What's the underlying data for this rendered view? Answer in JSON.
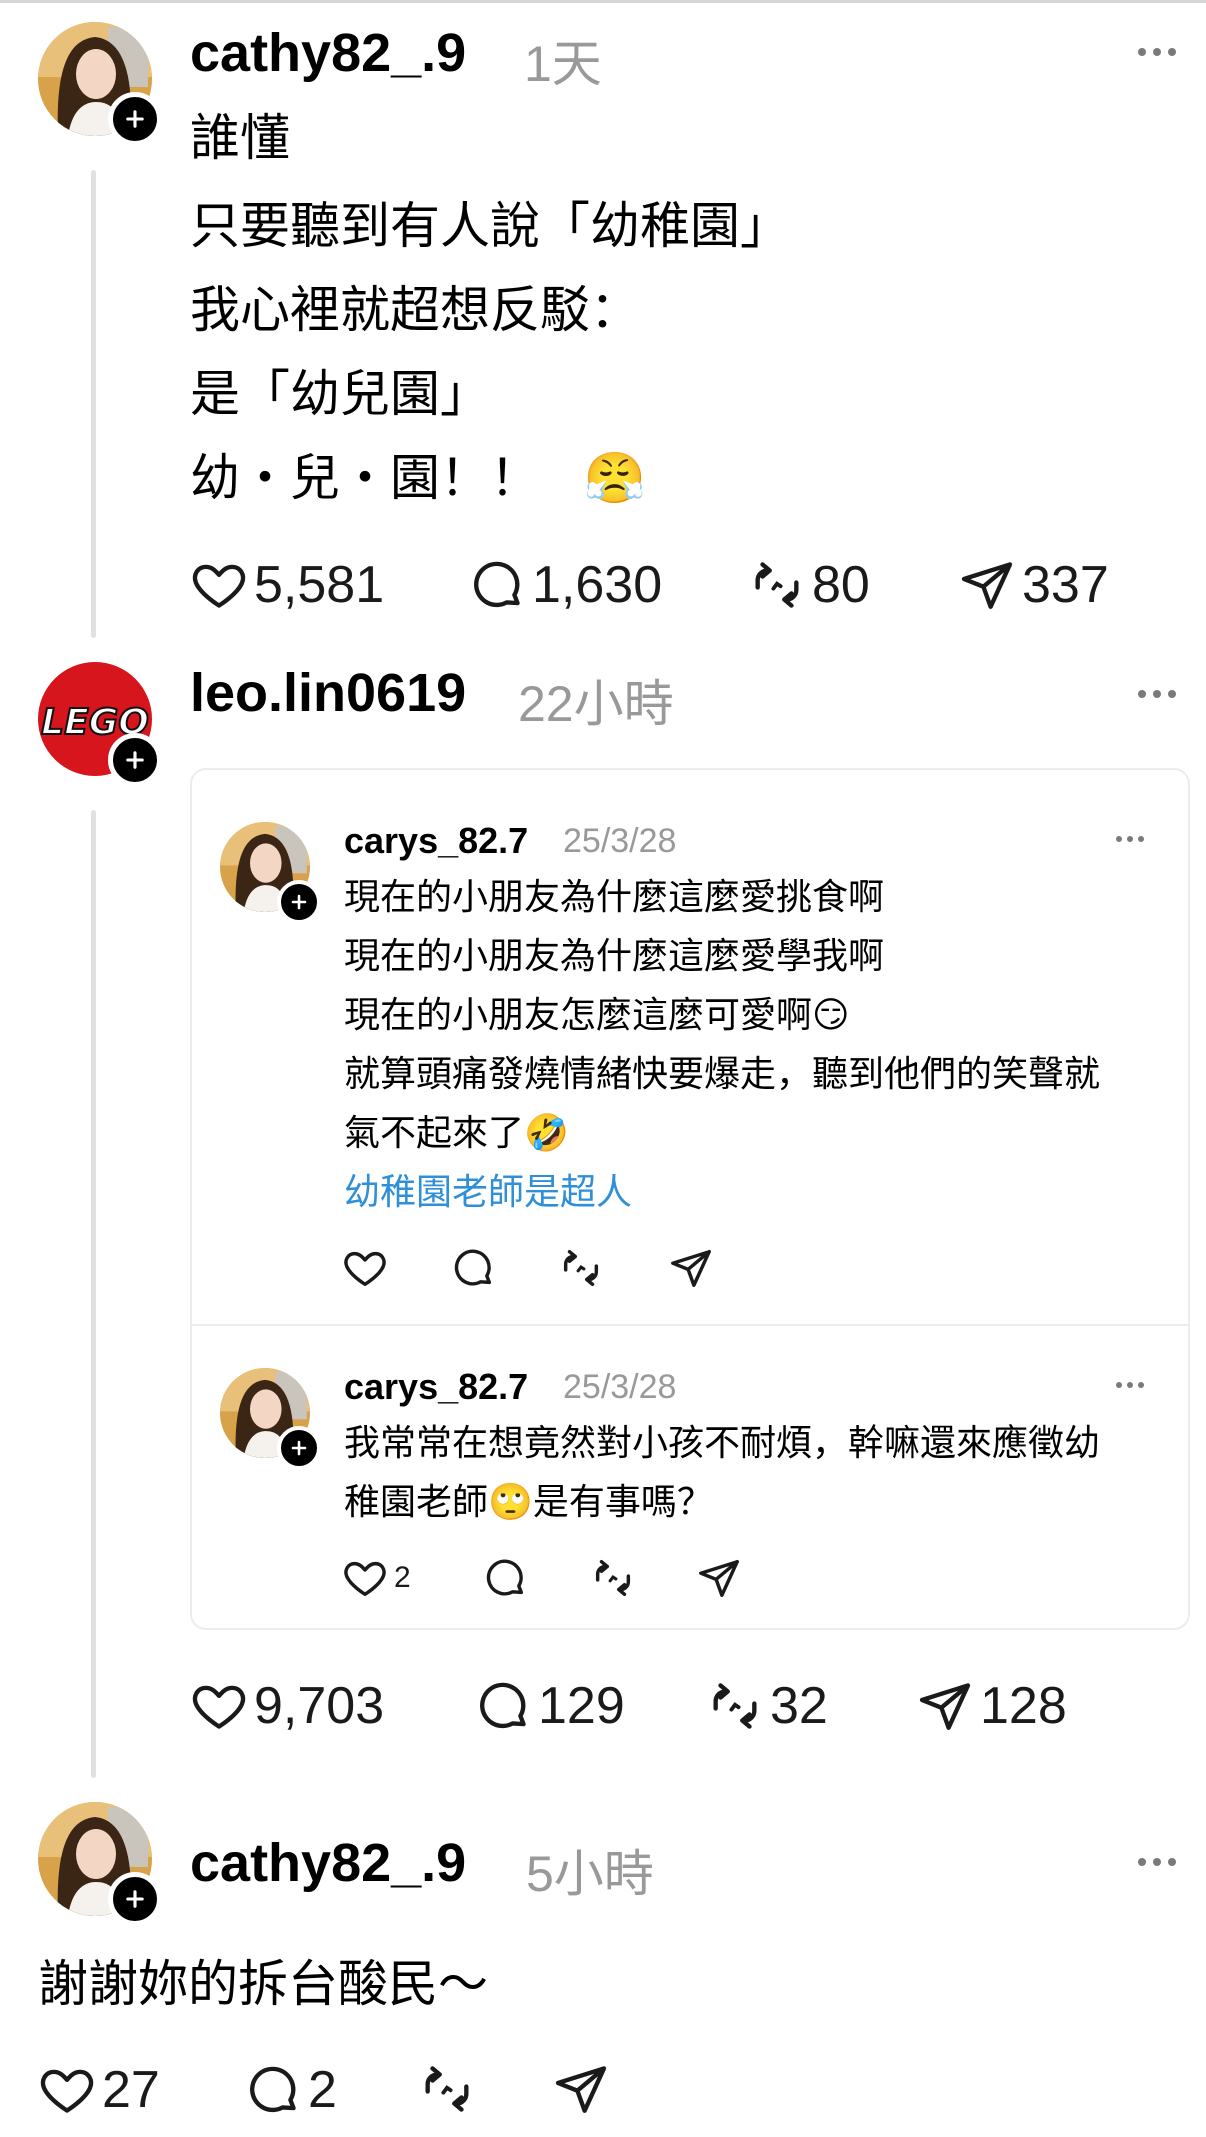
{
  "posts": [
    {
      "username": "cathy82_.9",
      "time": "1天",
      "lines": [
        "誰懂",
        "只要聽到有人說「幼稚園」",
        "我心裡就超想反駁：",
        "是「幼兒園」",
        "幼・兒・園！！"
      ],
      "emoji": "😤",
      "likes": "5,581",
      "comments": "1,630",
      "reposts": "80",
      "shares": "337"
    },
    {
      "username": "leo.lin0619",
      "time": "22小時",
      "avatar_text": "LEGO",
      "likes": "9,703",
      "comments": "129",
      "reposts": "32",
      "shares": "128"
    },
    {
      "username": "cathy82_.9",
      "time": "5小時",
      "text": "謝謝妳的拆台酸民～",
      "likes": "27",
      "comments": "2"
    }
  ],
  "quoted": [
    {
      "username": "carys_82.7",
      "time": "25/3/28",
      "lines": [
        "現在的小朋友為什麼這麼愛挑食啊",
        "現在的小朋友為什麼這麼愛學我啊",
        "現在的小朋友怎麼這麼可愛啊",
        "就算頭痛發燒情緒快要爆走，聽到他們的笑聲就",
        "氣不起來了"
      ],
      "emoji_1": "😏",
      "emoji_2": "🤣",
      "tag": "幼稚園老師是超人"
    },
    {
      "username": "carys_82.7",
      "time": "25/3/28",
      "line1": "我常常在想竟然對小孩不耐煩，幹嘛還來應徵幼",
      "line2a": "稚園老師",
      "emoji": "🙄",
      "line2b": "是有事嗎？",
      "likes": "2"
    }
  ],
  "colors": {
    "link": "#2f8fd8",
    "muted": "#999999",
    "icon": "#1a1a1a"
  }
}
